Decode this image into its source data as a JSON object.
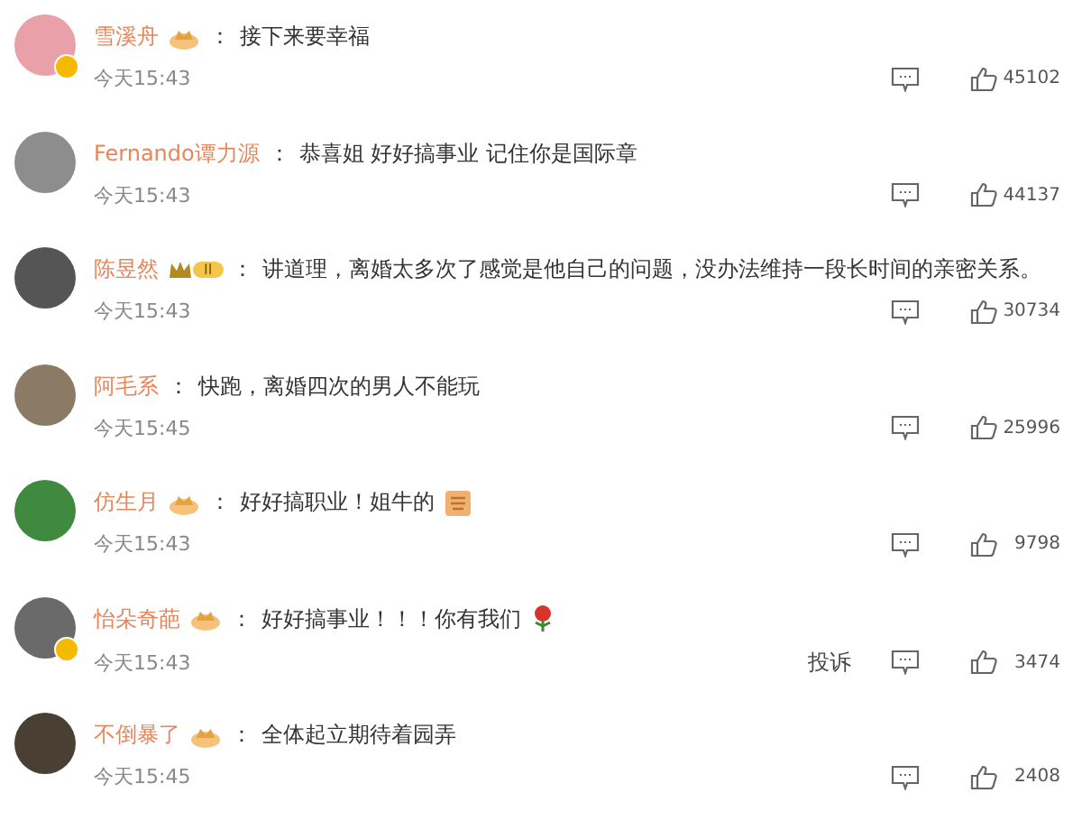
{
  "comments": [
    {
      "name": "雪溪舟",
      "verified": true,
      "badge": {
        "kind": "crown"
      },
      "separator": "：",
      "text": "接下来要幸福",
      "time": "今天15:43",
      "likes": "45102"
    },
    {
      "name": "Fernando谭力源",
      "verified": false,
      "separator": "：",
      "text": "恭喜姐 好好搞事业 记住你是国际章",
      "time": "今天15:43",
      "likes": "44137"
    },
    {
      "name": "陈昱然",
      "verified": false,
      "badge": {
        "kind": "vip",
        "label": "II"
      },
      "separator": "：",
      "text": "讲道理，离婚太多次了感觉是他自己的问题，没办法维持一段长时间的亲密关系。",
      "time": "今天15:43",
      "likes": "30734"
    },
    {
      "name": "阿毛系",
      "verified": false,
      "separator": "：",
      "text": "快跑，离婚四次的男人不能玩",
      "time": "今天15:45",
      "likes": "25996"
    },
    {
      "name": "仿生月",
      "verified": false,
      "badge": {
        "kind": "crown"
      },
      "separator": "：",
      "text": "好好搞职业！姐牛的",
      "emoji": {
        "kind": "sticker"
      },
      "time": "今天15:43",
      "likes": "9798"
    },
    {
      "name": "怡朵奇葩",
      "verified": true,
      "badge": {
        "kind": "crown"
      },
      "separator": "：",
      "text": "好好搞事业！！！你有我们",
      "emoji": {
        "kind": "rose"
      },
      "time": "今天15:43",
      "likes": "3474",
      "report": "投诉"
    },
    {
      "name": "不倒暴了",
      "verified": false,
      "badge": {
        "kind": "crown"
      },
      "separator": "：",
      "text": "全体起立期待着园弄",
      "time": "今天15:45",
      "likes": "2408"
    }
  ]
}
